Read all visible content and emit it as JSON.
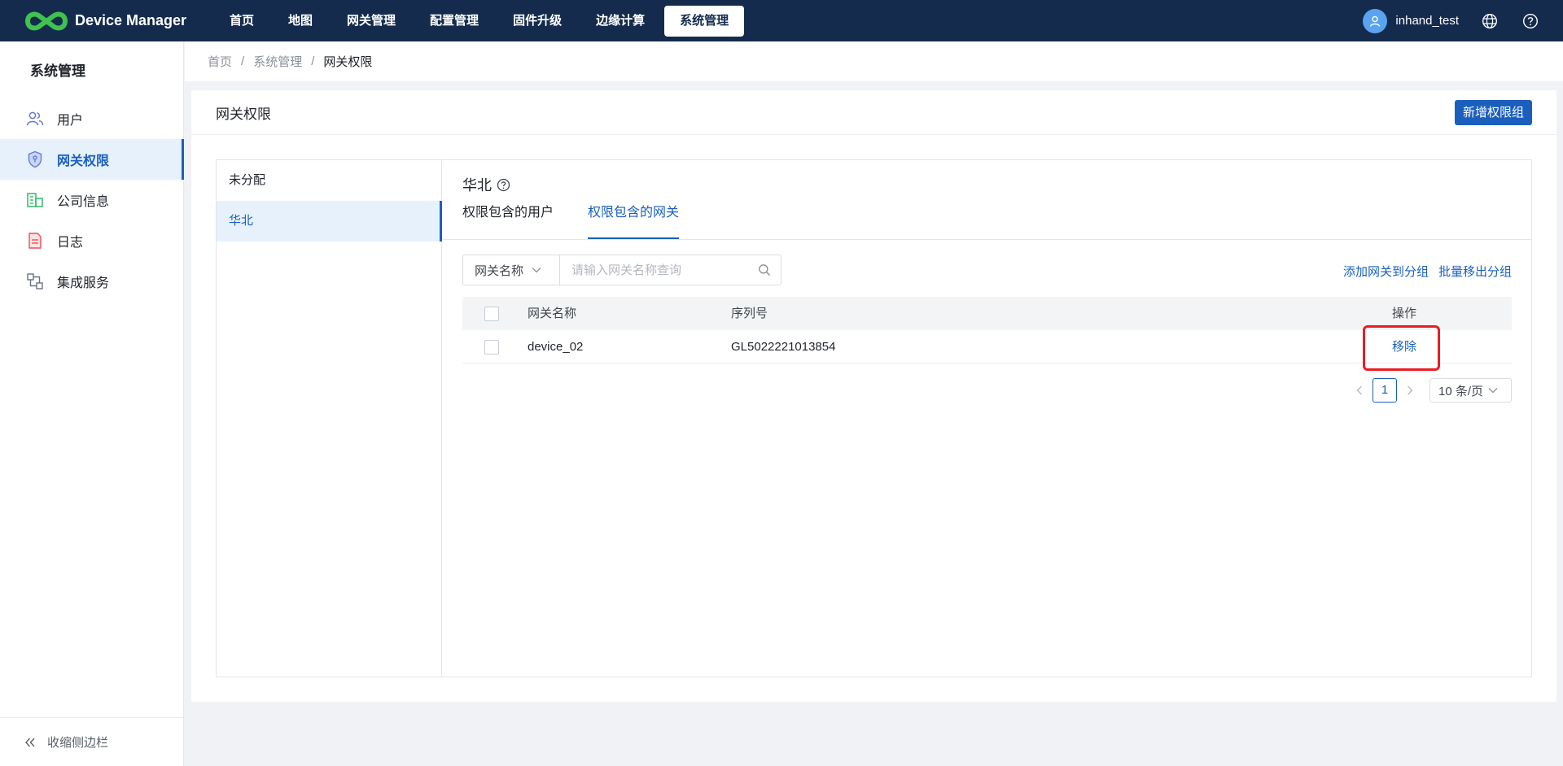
{
  "app": {
    "brand": "Device Manager",
    "colors": {
      "nav_bg": "#142b4e",
      "accent": "#1b5fbd",
      "highlight": "#ea1c24",
      "active_bg": "#e6f1fc"
    }
  },
  "topnav": {
    "items": [
      {
        "label": "首页"
      },
      {
        "label": "地图"
      },
      {
        "label": "网关管理"
      },
      {
        "label": "配置管理"
      },
      {
        "label": "固件升级"
      },
      {
        "label": "边缘计算"
      },
      {
        "label": "系统管理",
        "active": true
      }
    ],
    "username": "inhand_test",
    "icons": [
      "user-avatar-icon",
      "globe-icon",
      "help-circle-icon"
    ]
  },
  "sidebar": {
    "title": "系统管理",
    "items": [
      {
        "label": "用户",
        "icon": "users-icon"
      },
      {
        "label": "网关权限",
        "icon": "shield-icon",
        "active": true
      },
      {
        "label": "公司信息",
        "icon": "building-icon"
      },
      {
        "label": "日志",
        "icon": "log-document-icon"
      },
      {
        "label": "集成服务",
        "icon": "integration-icon"
      }
    ],
    "collapse_label": "收缩侧边栏"
  },
  "breadcrumb": [
    "首页",
    "系统管理",
    "网关权限"
  ],
  "page": {
    "title": "网关权限",
    "add_group_button": "新增权限组"
  },
  "groups": {
    "items": [
      {
        "label": "未分配"
      },
      {
        "label": "华北",
        "active": true
      }
    ]
  },
  "detail": {
    "title": "华北",
    "tabs": [
      {
        "label": "权限包含的用户"
      },
      {
        "label": "权限包含的网关",
        "active": true
      }
    ],
    "filter": {
      "field": "网关名称",
      "placeholder": "请输入网关名称查询"
    },
    "actions": {
      "add_to_group": "添加网关到分组",
      "batch_remove": "批量移出分组"
    },
    "table": {
      "columns": [
        "网关名称",
        "序列号",
        "操作"
      ],
      "rows": [
        {
          "name": "device_02",
          "serial": "GL5022221013854",
          "action": "移除"
        }
      ]
    },
    "pagination": {
      "current_page": "1",
      "page_size": "10 条/页"
    }
  }
}
